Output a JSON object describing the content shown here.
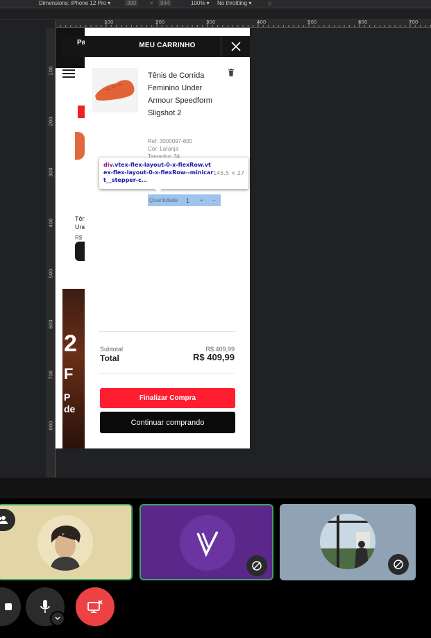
{
  "devtools": {
    "device": "Dimensions: iPhone 12 Pro ▾",
    "width": "390",
    "times": "×",
    "height": "844",
    "zoom": "100% ▾",
    "throttling": "No throttling ▾"
  },
  "rulers": {
    "top": [
      "100",
      "200",
      "300",
      "400",
      "500",
      "600",
      "700"
    ],
    "top_small": [
      "100",
      "200",
      "300"
    ],
    "left": [
      "100",
      "200",
      "300",
      "400",
      "500",
      "600",
      "700",
      "800"
    ]
  },
  "page": {
    "tab_label": "Pa",
    "product_prefix": "Têr",
    "product_prefix2": "Une",
    "price_prefix": "R$",
    "promo_big": "2",
    "promo_f": "F",
    "promo_p": "P",
    "promo_de": "de"
  },
  "cart": {
    "title": "MEU CARRINHO",
    "item": {
      "name": "Tênis de Corrida Feminino Under Armour Speedform Sligshot 2",
      "ref": "Ref: 3000097-600",
      "color": "Cor: Laranja",
      "size": "Tamanho: 34"
    },
    "quantity_label": "Quantidade",
    "quantity_value": "1",
    "quantity_plus": "+",
    "quantity_minus": "−",
    "subtotal_label": "Subtotal",
    "subtotal_value": "R$ 409,99",
    "total_label": "Total",
    "total_value": "R$ 409,99",
    "finalize_label": "Finalizar Compra",
    "continue_label": "Continuar comprando"
  },
  "inspector": {
    "tag": "div",
    "classes": ".vtex-flex-layout-0-x-flexRow.vtex-flex-layout-0-x-flexRow--minicart__stepper-c…",
    "size": "145.5 × 27"
  },
  "colors": {
    "accent_red": "#fe1e30",
    "call_active_border": "#3ba55c",
    "share_red": "#ed4245"
  }
}
